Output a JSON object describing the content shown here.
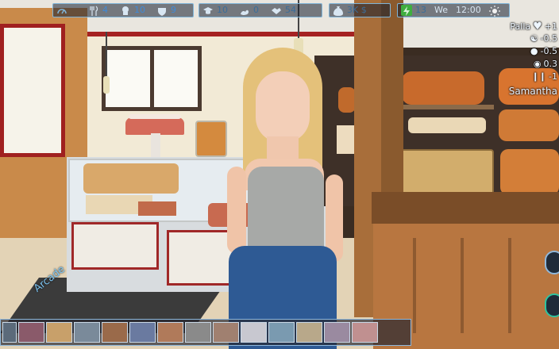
{
  "hud": {
    "stat_speed": "",
    "stat_food": "4",
    "stat_skill": "10",
    "stat_mood": "9",
    "stat_education": "10",
    "stat_strength": "0",
    "stat_social": "54",
    "money": "3K $",
    "energy": "13",
    "day": "We",
    "time": "12:00"
  },
  "status": {
    "name_line": "Palla",
    "name_delta": "+1",
    "lines": [
      {
        "icon": "mask-icon",
        "value": "-0.5"
      },
      {
        "icon": "money-icon",
        "value": "-0.5"
      },
      {
        "icon": "food-icon",
        "value": "0.3"
      },
      {
        "icon": "cutlery-icon",
        "value": "-1"
      }
    ],
    "character": "Samantha"
  },
  "location_label": "Arcade",
  "thumb_count": 14,
  "colors": {
    "accent": "#3f8ad8",
    "hud_border": "#7fb4d8"
  }
}
